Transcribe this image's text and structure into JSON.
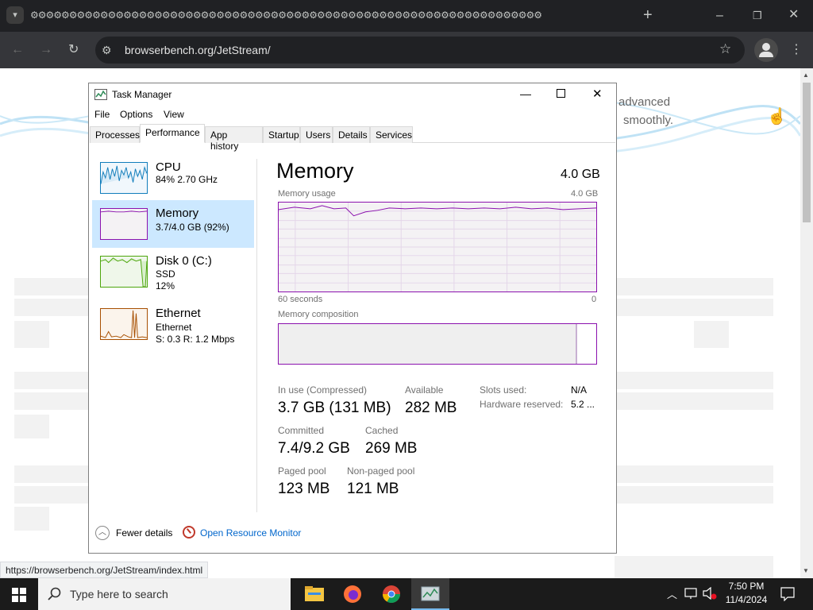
{
  "browser": {
    "tab_title": "⚙⚙⚙⚙⚙⚙⚙⚙⚙⚙⚙⚙⚙⚙⚙⚙⚙⚙⚙⚙⚙⚙⚙⚙⚙⚙⚙⚙⚙⚙⚙⚙⚙⚙⚙⚙⚙⚙⚙⚙⚙⚙⚙⚙⚙⚙⚙⚙⚙⚙⚙⚙⚙⚙⚙⚙⚙⚙⚙⚙⚙⚙⚙⚙⚙⚙",
    "new_tab": "+",
    "url": "browserbench.org/JetStream/",
    "status_url": "https://browserbench.org/JetStream/index.html"
  },
  "page": {
    "text_line1": "advanced",
    "text_line2": "smoothly."
  },
  "taskmgr": {
    "title": "Task Manager",
    "menu": [
      "File",
      "Options",
      "View"
    ],
    "tabs": [
      "Processes",
      "Performance",
      "App history",
      "Startup",
      "Users",
      "Details",
      "Services"
    ],
    "active_tab": "Performance",
    "resources": [
      {
        "name": "CPU",
        "sub1": "84% 2.70 GHz",
        "sub2": "",
        "color": "#117dbb"
      },
      {
        "name": "Memory",
        "sub1": "3.7/4.0 GB (92%)",
        "sub2": "",
        "color": "#8b12ae"
      },
      {
        "name": "Disk 0 (C:)",
        "sub1": "SSD",
        "sub2": "12%",
        "color": "#4da60c"
      },
      {
        "name": "Ethernet",
        "sub1": "Ethernet",
        "sub2": "S: 0.3  R: 1.2 Mbps",
        "color": "#a74f01"
      }
    ],
    "panel": {
      "heading": "Memory",
      "total": "4.0 GB",
      "usage_label": "Memory usage",
      "usage_max": "4.0 GB",
      "x_left": "60 seconds",
      "x_right": "0",
      "composition_label": "Memory composition",
      "in_use_label": "In use (Compressed)",
      "in_use_value": "3.7 GB (131 MB)",
      "available_label": "Available",
      "available_value": "282 MB",
      "slots_label": "Slots used:",
      "slots_value": "N/A",
      "hw_reserved_label": "Hardware reserved:",
      "hw_reserved_value": "5.2 ...",
      "committed_label": "Committed",
      "committed_value": "7.4/9.2 GB",
      "cached_label": "Cached",
      "cached_value": "269 MB",
      "paged_label": "Paged pool",
      "paged_value": "123 MB",
      "nonpaged_label": "Non-paged pool",
      "nonpaged_value": "121 MB"
    },
    "footer": {
      "fewer_details": "Fewer details",
      "open_monitor": "Open Resource Monitor"
    }
  },
  "taskbar": {
    "search_placeholder": "Type here to search",
    "time": "7:50 PM",
    "date": "11/4/2024"
  }
}
